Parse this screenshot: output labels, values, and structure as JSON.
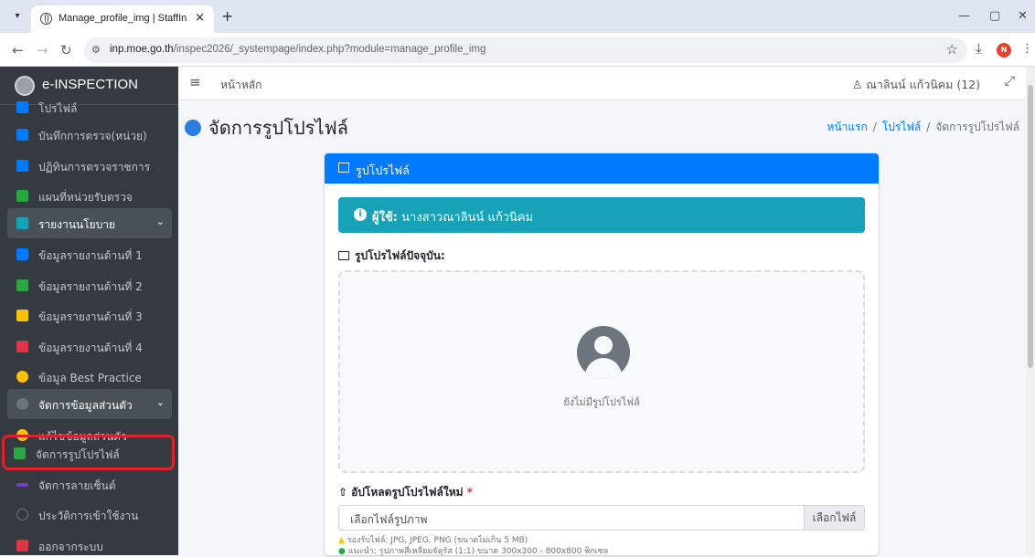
{
  "browser": {
    "tab_title": "Manage_profile_img | StaffInsp",
    "tab_close": "×",
    "new_tab": "+",
    "url_prefix": "inp.moe.go.th",
    "url_path": "/inspec2026/_systempage/index.php?module=manage_profile_img",
    "profile_initial": "N"
  },
  "sidebar": {
    "brand": "e-INSPECTION",
    "items": [
      {
        "label": "โปรไฟล์",
        "icon": "user-icon",
        "color": "#007bff"
      },
      {
        "label": "บันทึกการตรวจ(หน่วย)",
        "icon": "users-icon",
        "color": "#007bff"
      },
      {
        "label": "ปฏิทินการตรวจราชการ",
        "icon": "calendar-icon",
        "color": "#007bff"
      },
      {
        "label": "แผนที่หน่วยรับตรวจ",
        "icon": "map-icon",
        "color": "#28a745"
      },
      {
        "label": "รายงานนโยบาย",
        "icon": "document-icon",
        "color": "#17a2b8"
      },
      {
        "label": "ข้อมูลรายงานด้านที่ 1",
        "icon": "file-icon",
        "color": "#007bff"
      },
      {
        "label": "ข้อมูลรายงานด้านที่ 2",
        "icon": "file-icon",
        "color": "#28a745"
      },
      {
        "label": "ข้อมูลรายงานด้านที่ 3",
        "icon": "file-icon",
        "color": "#ffc107"
      },
      {
        "label": "ข้อมูลรายงานด้านที่ 4",
        "icon": "file-icon",
        "color": "#dc3545"
      },
      {
        "label": "ข้อมูล Best Practice",
        "icon": "award-icon",
        "color": "#ffc107"
      },
      {
        "label": "จัดการข้อมูลส่วนตัว",
        "icon": "cogs-icon",
        "color": "#6c757d"
      },
      {
        "label": "แก้ไขข้อมูลส่วนตัว",
        "icon": "user-edit-icon",
        "color": "#ffc107"
      },
      {
        "label": "จัดการรูปโปรไฟล์",
        "icon": "image-icon",
        "color": "#28a745"
      },
      {
        "label": "จัดการลายเซ็นต์",
        "icon": "signature-icon",
        "color": "#6f42c1"
      },
      {
        "label": "ประวัติการเข้าใช้งาน",
        "icon": "history-icon",
        "color": "#6c757d"
      },
      {
        "label": "ออกจากระบบ",
        "icon": "sign-out-icon",
        "color": "#dc3545"
      }
    ]
  },
  "header": {
    "home": "หน้าหลัก",
    "user": "ณาลินน์ แก้วนิคม (12)"
  },
  "page": {
    "title": "จัดการรูปโปรไฟล์",
    "breadcrumb": [
      "หน้าแรก",
      "โปรไฟล์",
      "จัดการรูปโปรไฟล์"
    ],
    "breadcrumb_sep": "/"
  },
  "card": {
    "header": "รูปโปรไฟล์",
    "alert_label": "ผู้ใช้:",
    "alert_value": "นางสาวณาลินน์ แก้วนิคม",
    "current_label": "รูปโปรไฟล์ปัจจุบัน:",
    "no_profile": "ยังไม่มีรูปโปรไฟล์",
    "upload_label": "อัปโหลดรูปโปรไฟล์ใหม่",
    "required_mark": "*",
    "file_placeholder": "เลือกไฟล์รูปภาพ",
    "browse_button": "เลือกไฟล์",
    "hint_formats": "รองรับไฟล์: JPG, JPEG, PNG (ขนาดไม่เกิน 5 MB)",
    "hint_size": "แนะนำ: รูปภาพสี่เหลี่ยมจัตุรัส (1:1) ขนาด 300x300 - 800x800 พิกเซล"
  }
}
